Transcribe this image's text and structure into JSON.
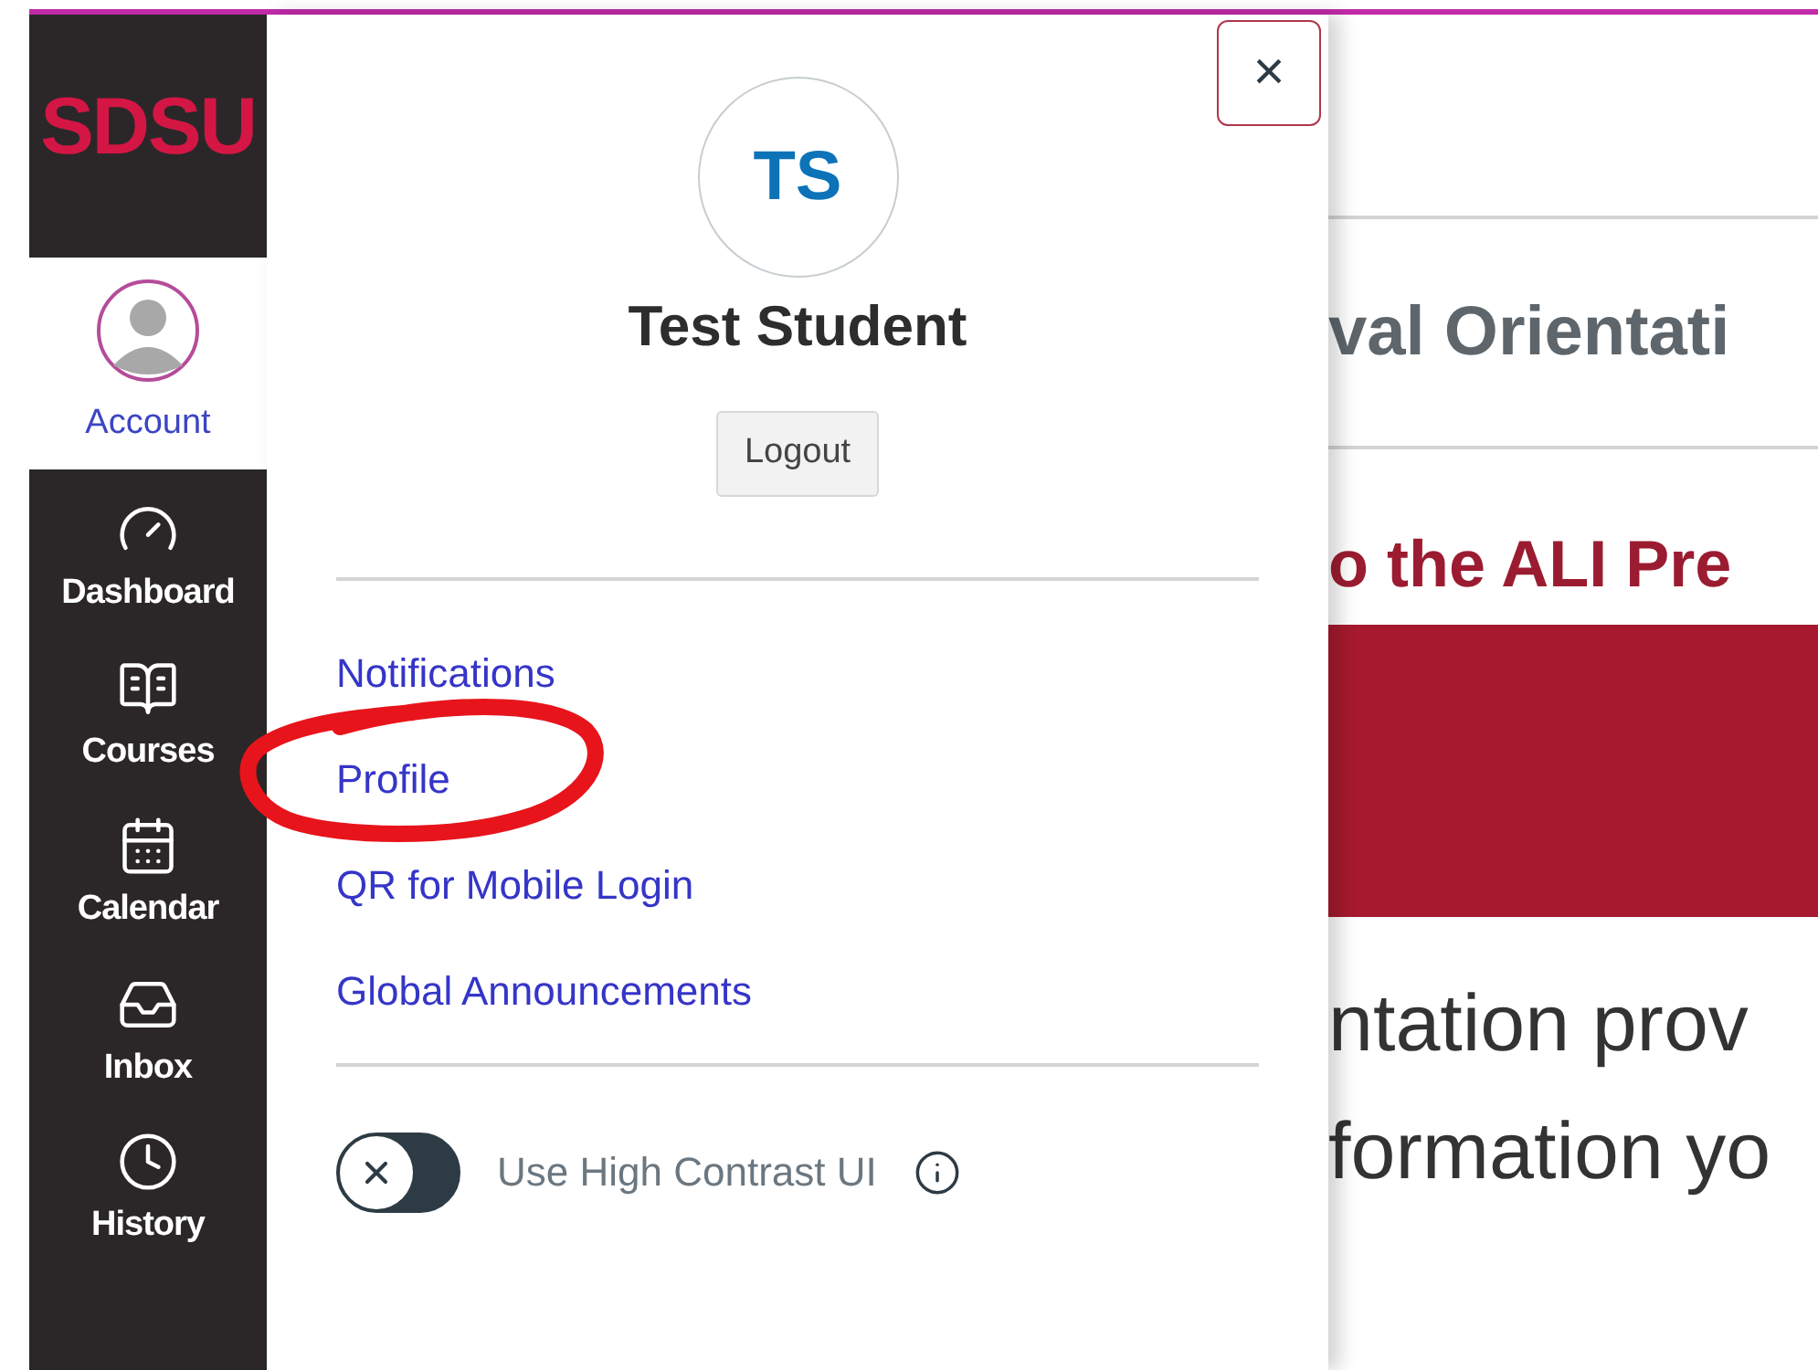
{
  "sidebar": {
    "logo": "SDSU",
    "account": {
      "label": "Account",
      "selected": true
    },
    "items": [
      {
        "label": "Dashboard",
        "kind": "gauge"
      },
      {
        "label": "Courses",
        "kind": "book"
      },
      {
        "label": "Calendar",
        "kind": "calendar"
      },
      {
        "label": "Inbox",
        "kind": "inbox"
      },
      {
        "label": "History",
        "kind": "clock"
      }
    ]
  },
  "tray": {
    "close": "×",
    "initials": "TS",
    "name": "Test Student",
    "logout": "Logout",
    "links": [
      {
        "label": "Notifications",
        "annotated": false
      },
      {
        "label": "Profile",
        "annotated": true
      },
      {
        "label": "QR for Mobile Login",
        "annotated": false
      },
      {
        "label": "Global Announcements",
        "annotated": false
      }
    ],
    "toggle": {
      "label": "Use High Contrast UI",
      "on": false
    }
  },
  "content": {
    "title": "val Orientati",
    "heading": "o the ALI Pre",
    "lines": [
      "ntation prov",
      "formation yo"
    ]
  }
}
